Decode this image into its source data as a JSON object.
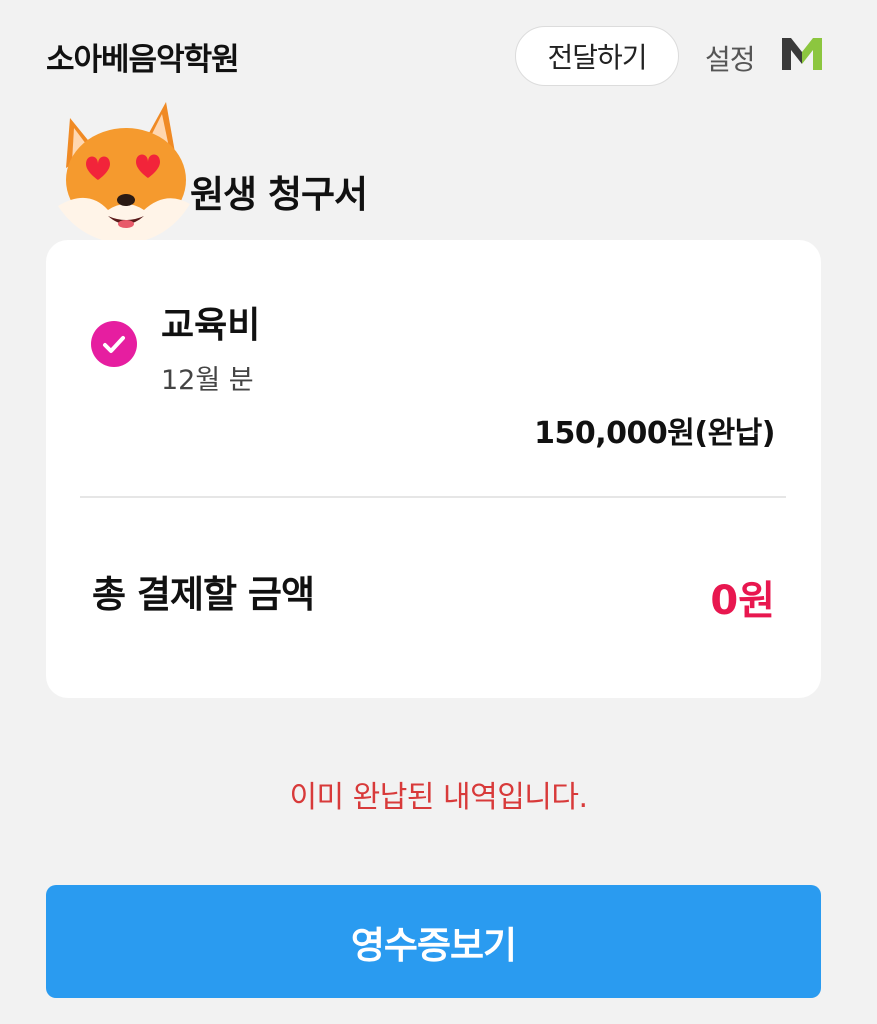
{
  "header": {
    "academy_name": "소아베음악학원",
    "share_label": "전달하기",
    "settings_label": "설정",
    "logo_icon": "m-brand-icon",
    "logo_colors": [
      "#3a3a3a",
      "#8cc63f"
    ]
  },
  "sticker_icon": "fox-heart-eyes-emoji",
  "page_title": "원생 청구서",
  "invoice": {
    "item": {
      "checked": true,
      "title": "교육비",
      "period": "12월 분",
      "amount": "150,000원(완납)"
    },
    "total_label": "총 결제할 금액",
    "total_amount": "0원"
  },
  "notice": "이미 완납된 내역입니다.",
  "receipt_button_label": "영수증보기",
  "colors": {
    "background": "#f2f2f2",
    "check": "#e61ea0",
    "total_amount": "#e8174f",
    "notice": "#d83a3a",
    "primary_button": "#2a9bf0"
  }
}
